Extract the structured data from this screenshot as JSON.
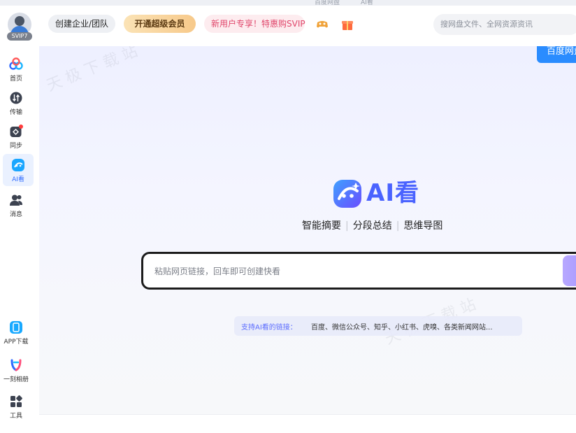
{
  "window_strip": {
    "left_text": "百度网盘",
    "right_text": "AI看"
  },
  "header": {
    "avatar_badge": "SVIP7",
    "team_button": "创建企业/团队",
    "svip_button": "开通超级会员",
    "promo_button": "新用户专享！特惠购SVIP",
    "search_placeholder": "搜网盘文件、全网资源资讯",
    "icons": [
      "game-icon",
      "gift-icon"
    ]
  },
  "sidebar": {
    "items": [
      {
        "label": "首页",
        "icon": "home-icon"
      },
      {
        "label": "传输",
        "icon": "transfer-icon"
      },
      {
        "label": "同步",
        "icon": "sync-icon"
      },
      {
        "label": "AI看",
        "icon": "ai-view-icon",
        "active": true
      },
      {
        "label": "消息",
        "icon": "message-icon"
      }
    ],
    "bottom_items": [
      {
        "label": "APP下载",
        "icon": "phone-icon"
      },
      {
        "label": "一刻相册",
        "icon": "album-icon"
      },
      {
        "label": "工具",
        "icon": "tools-icon"
      }
    ]
  },
  "main": {
    "corner_button": "百度网盘",
    "brand_title": "AI看",
    "features": [
      "智能摘要",
      "分段总结",
      "思维导图"
    ],
    "paste_placeholder": "粘贴网页链接，回车即可创建快看",
    "support_label": "支持AI看的链接：",
    "support_sites": "百度、微信公众号、知乎、小红书、虎嗅、各类新闻网站..."
  },
  "colors": {
    "accent": "#4a63ff",
    "corner_button": "#2a8cff",
    "promo_text": "#e0466b"
  }
}
